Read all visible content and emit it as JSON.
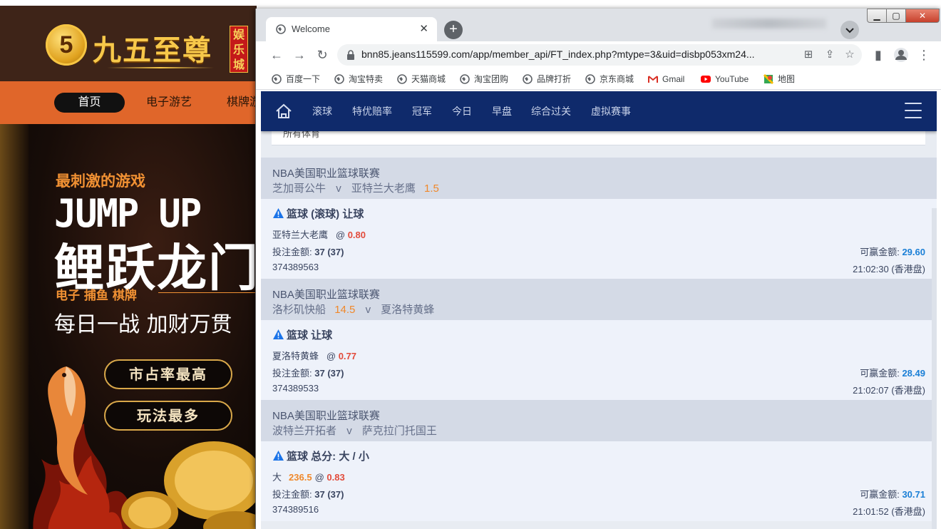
{
  "background_site": {
    "logo_text": "九五至尊",
    "logo_badge": "娱乐城",
    "nav": [
      "首页",
      "电子游艺",
      "棋牌游"
    ],
    "banner": {
      "line1": "最刺激的游戏",
      "line2": "JUMP UP",
      "line3": "鲤跃龙门",
      "line4": "电子 捕鱼 棋牌",
      "line5": "每日一战 加财万贯",
      "pill1": "市占率最高",
      "pill2": "玩法最多"
    }
  },
  "browser": {
    "tab_title": "Welcome",
    "tab_close": "✕",
    "new_tab": "+",
    "url": "bnn85.jeans115599.com/app/member_api/FT_index.php?mtype=3&uid=disbp053xm24...",
    "bookmarks": [
      "百度一下",
      "淘宝特卖",
      "天猫商城",
      "淘宝团购",
      "品牌打折",
      "京东商城",
      "Gmail",
      "YouTube",
      "地图"
    ]
  },
  "app": {
    "nav": [
      "滚球",
      "特优赔率",
      "冠军",
      "今日",
      "早盘",
      "综合过关",
      "虚拟赛事"
    ],
    "filter_label": "所有体育",
    "bets": [
      {
        "league": "NBA美国职业篮球联赛",
        "home": "芝加哥公牛",
        "vs": "v",
        "away": "亚特兰大老鹰",
        "home_hcap": "",
        "away_hcap": "1.5",
        "bet_type": "篮球 (滚球) 让球",
        "selection": "亚特兰大老鹰",
        "line": "",
        "at": "@",
        "odds": "0.80",
        "stake_label": "投注金额:",
        "stake": "37 (37)",
        "win_label": "可赢金额:",
        "win": "29.60",
        "ticket": "374389563",
        "time": "21:02:30 (香港盘)"
      },
      {
        "league": "NBA美国职业篮球联赛",
        "home": "洛杉矶快船",
        "vs": "v",
        "away": "夏洛特黄蜂",
        "home_hcap": "14.5",
        "away_hcap": "",
        "bet_type": "篮球 让球",
        "selection": "夏洛特黄蜂",
        "line": "",
        "at": "@",
        "odds": "0.77",
        "stake_label": "投注金额:",
        "stake": "37 (37)",
        "win_label": "可赢金额:",
        "win": "28.49",
        "ticket": "374389533",
        "time": "21:02:07 (香港盘)"
      },
      {
        "league": "NBA美国职业篮球联赛",
        "home": "波特兰开拓者",
        "vs": "v",
        "away": "萨克拉门托国王",
        "home_hcap": "",
        "away_hcap": "",
        "bet_type": "篮球 总分: 大 / 小",
        "selection": "大",
        "line": "236.5",
        "at": "@",
        "odds": "0.83",
        "stake_label": "投注金额:",
        "stake": "37 (37)",
        "win_label": "可赢金额:",
        "win": "30.71",
        "ticket": "374389516",
        "time": "21:01:52 (香港盘)"
      }
    ]
  },
  "colors": {
    "app_nav_bg": "#0f2a6b",
    "league_bg": "#d4dae6",
    "body_bg": "#eef2fa",
    "odds": "#e24b3b",
    "handicap": "#f0882a",
    "win_amount": "#1a7fd6",
    "warning_icon": "#1a73e8"
  }
}
